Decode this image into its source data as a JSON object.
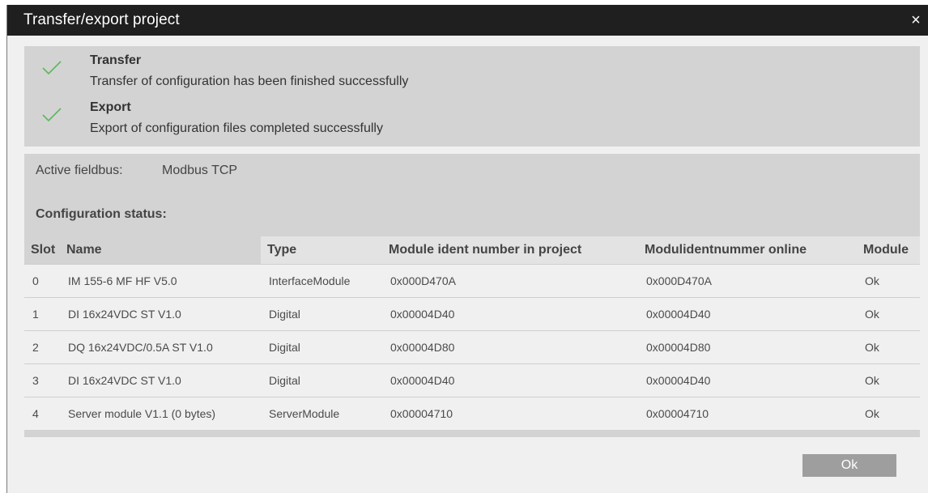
{
  "dialog": {
    "title": "Transfer/export project",
    "close_label": "×"
  },
  "status": {
    "icon": "check-icon",
    "check_color": "#5cb85c",
    "transfer": {
      "title": "Transfer",
      "description": "Transfer of configuration has been finished successfully"
    },
    "export": {
      "title": "Export",
      "description": "Export of configuration files completed successfully"
    }
  },
  "config": {
    "fieldbus_label": "Active fieldbus:",
    "fieldbus_value": "Modbus TCP",
    "status_label": "Configuration status:"
  },
  "table": {
    "headers": [
      "Slot",
      "Name",
      "Type",
      "Module ident number in project",
      "Modulidentnummer online",
      "Module"
    ],
    "rows": [
      [
        "0",
        "IM 155-6 MF HF V5.0",
        "InterfaceModule",
        "0x000D470A",
        "0x000D470A",
        "Ok"
      ],
      [
        "1",
        "DI 16x24VDC ST V1.0",
        "Digital",
        "0x00004D40",
        "0x00004D40",
        "Ok"
      ],
      [
        "2",
        "DQ 16x24VDC/0.5A ST V1.0",
        "Digital",
        "0x00004D80",
        "0x00004D80",
        "Ok"
      ],
      [
        "3",
        "DI 16x24VDC ST V1.0",
        "Digital",
        "0x00004D40",
        "0x00004D40",
        "Ok"
      ],
      [
        "4",
        "Server module V1.1 (0 bytes)",
        "ServerModule",
        "0x00004710",
        "0x00004710",
        "Ok"
      ]
    ]
  },
  "footer": {
    "ok_label": "Ok"
  }
}
